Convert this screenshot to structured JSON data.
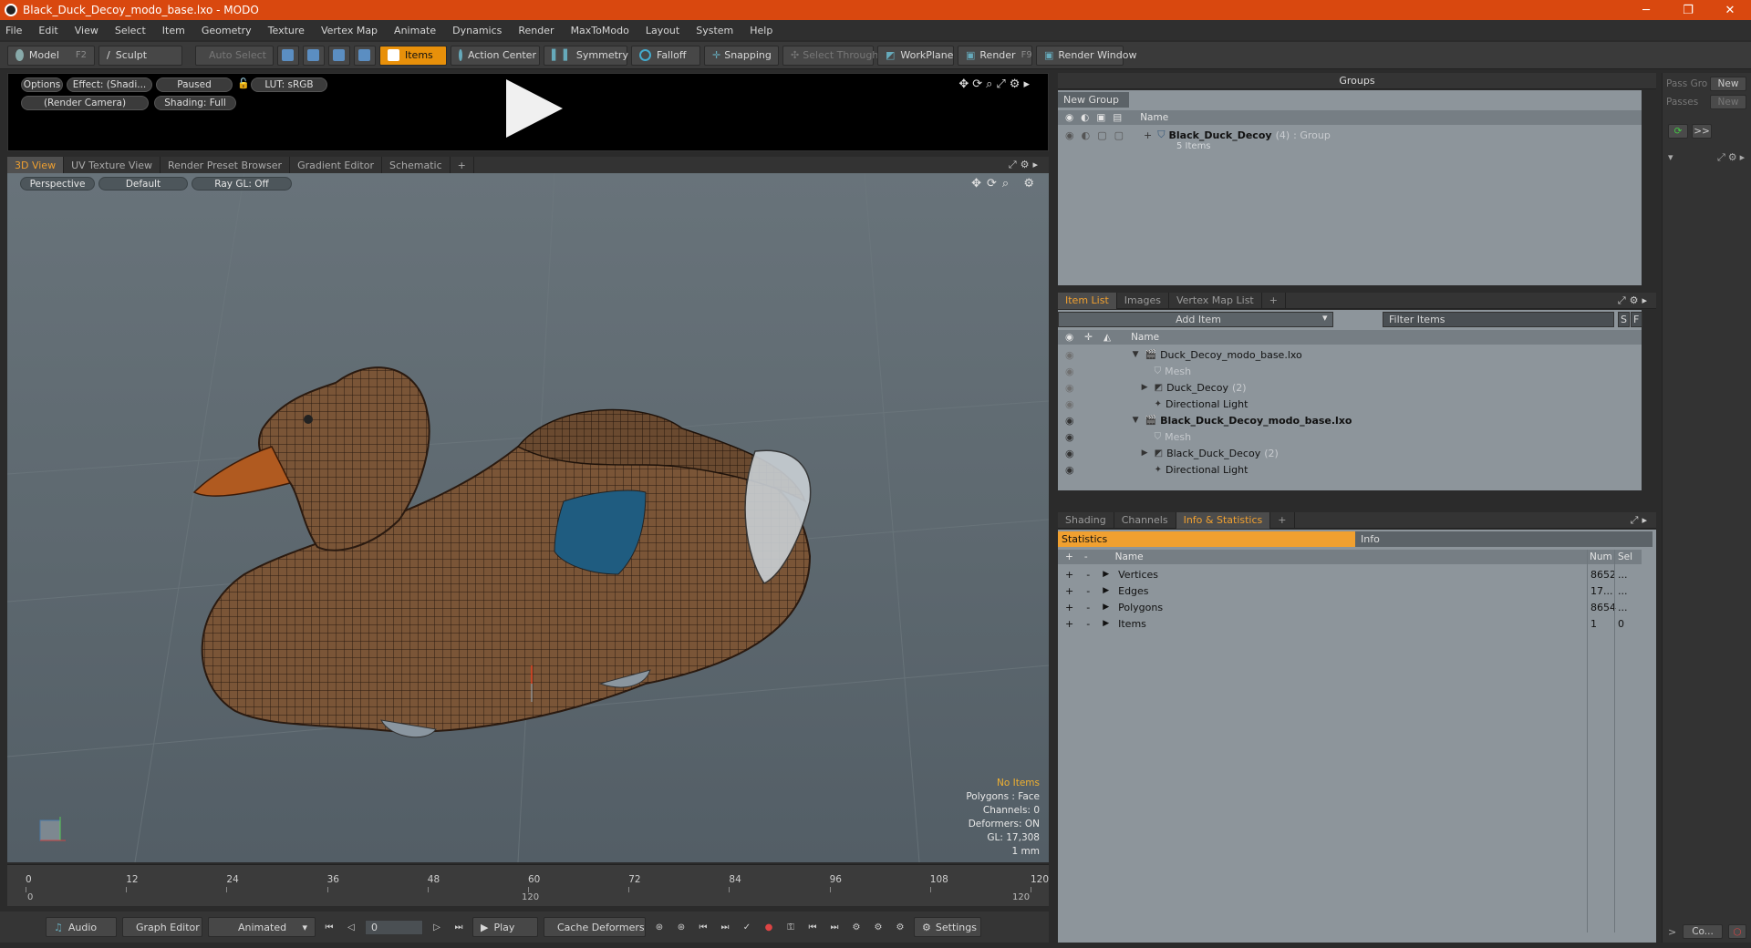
{
  "window": {
    "title": "Black_Duck_Decoy_modo_base.lxo - MODO",
    "minimize": "─",
    "maximize": "❐",
    "close": "✕"
  },
  "menu": [
    "File",
    "Edit",
    "View",
    "Select",
    "Item",
    "Geometry",
    "Texture",
    "Vertex Map",
    "Animate",
    "Dynamics",
    "Render",
    "MaxToModo",
    "Layout",
    "System",
    "Help"
  ],
  "toolbar": {
    "model": "Model",
    "model_key": "F2",
    "sculpt": "Sculpt",
    "auto_select": "Auto Select",
    "items": "Items",
    "action_center": "Action Center",
    "symmetry": "Symmetry",
    "falloff": "Falloff",
    "snapping": "Snapping",
    "select_through": "Select Through",
    "workplane": "WorkPlane",
    "render": "Render",
    "render_key": "F9",
    "render_window": "Render Window"
  },
  "preview": {
    "options": "Options",
    "effect": "Effect: (Shadi...",
    "paused": "Paused",
    "lut": "LUT: sRGB",
    "camera": "(Render Camera)",
    "shading": "Shading: Full"
  },
  "viewport_tabs": [
    "3D View",
    "UV Texture View",
    "Render Preset Browser",
    "Gradient Editor",
    "Schematic",
    "+"
  ],
  "viewport": {
    "perspective": "Perspective",
    "default": "Default",
    "raygl": "Ray GL: Off",
    "info": {
      "no_items": "No Items",
      "polygons": "Polygons : Face",
      "channels": "Channels: 0",
      "deformers": "Deformers: ON",
      "gl": "GL: 17,308",
      "unit": "1 mm"
    }
  },
  "timeline": {
    "ticks": [
      "0",
      "12",
      "24",
      "36",
      "48",
      "60",
      "72",
      "84",
      "96",
      "108",
      "120"
    ],
    "sub_ticks": [
      "0",
      "120",
      "120"
    ]
  },
  "bottombar": {
    "audio": "Audio",
    "graph_editor": "Graph Editor",
    "animated": "Animated",
    "frame": "0",
    "play": "Play",
    "cache": "Cache Deformers",
    "settings": "Settings"
  },
  "groups": {
    "title": "Groups",
    "new_group": "New Group",
    "col_name": "Name",
    "row_name": "Black_Duck_Decoy",
    "row_count": "(4)",
    "row_type": ": Group",
    "row_sub": "5 Items"
  },
  "item_list": {
    "tabs": [
      "Item List",
      "Images",
      "Vertex Map List",
      "+"
    ],
    "add_item": "Add Item",
    "filter": "Filter Items",
    "s": "S",
    "f": "F",
    "col_name": "Name",
    "rows": [
      {
        "label": "Duck_Decoy_modo_base.lxo",
        "count": ""
      },
      {
        "label": "Mesh",
        "count": ""
      },
      {
        "label": "Duck_Decoy",
        "count": "(2)"
      },
      {
        "label": "Directional Light",
        "count": ""
      },
      {
        "label": "Black_Duck_Decoy_modo_base.lxo",
        "count": ""
      },
      {
        "label": "Mesh",
        "count": ""
      },
      {
        "label": "Black_Duck_Decoy",
        "count": "(2)"
      },
      {
        "label": "Directional Light",
        "count": ""
      }
    ]
  },
  "stats": {
    "tabs": [
      "Shading",
      "Channels",
      "Info & Statistics",
      "+"
    ],
    "statistics": "Statistics",
    "info": "Info",
    "col_name": "Name",
    "col_num": "Num",
    "col_sel": "Sel",
    "rows": [
      {
        "name": "Vertices",
        "num": "8652",
        "sel": "..."
      },
      {
        "name": "Edges",
        "num": "17...",
        "sel": "..."
      },
      {
        "name": "Polygons",
        "num": "8654",
        "sel": "..."
      },
      {
        "name": "Items",
        "num": "1",
        "sel": "0"
      }
    ]
  },
  "far_right": {
    "pass_grp": "Pass Gro",
    "new1": "New",
    "passes": "Passes",
    "new2": "New",
    "arrows": ">>",
    "co": "Co..."
  }
}
